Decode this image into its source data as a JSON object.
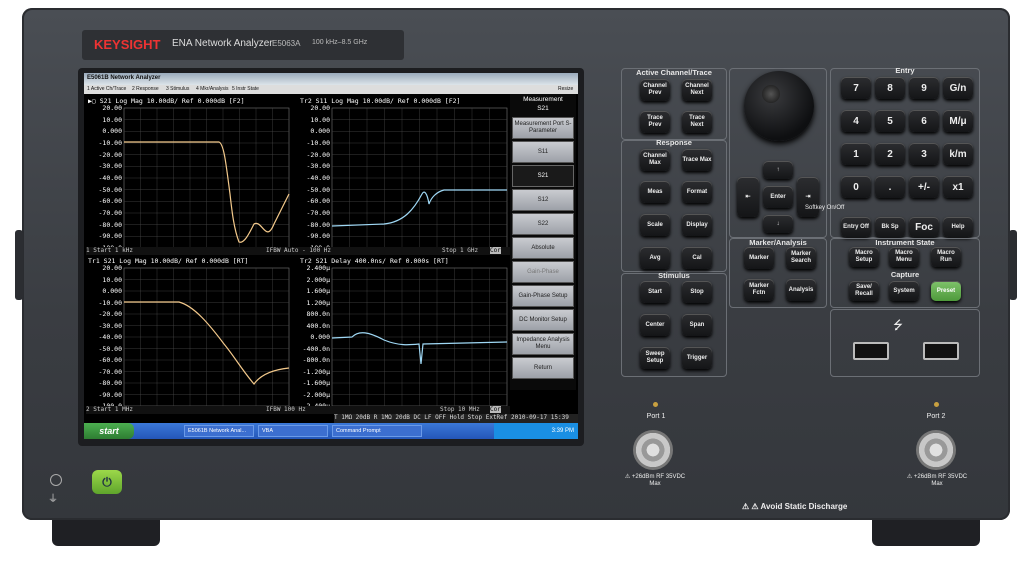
{
  "brand": {
    "logo": "KEYSIGHT",
    "product": "ENA Network Analyzer",
    "model": "E5063A",
    "range": "100 kHz–8.5 GHz"
  },
  "screen": {
    "window_title": "E5061B Network Analyzer",
    "menu": [
      "1 Active Ch/Trace",
      "2 Response",
      "3 Stimulus",
      "4 Mkr/Analysis",
      "5 Instr State"
    ],
    "menu_right": "Resize",
    "panels": [
      {
        "header": "S21 Log Mag 10.00dB/ Ref 0.000dB [F2]",
        "prefix": "Tr1",
        "yticks": [
          "20.00",
          "10.00",
          "0.000",
          "-10.00",
          "-20.00",
          "-30.00",
          "-40.00",
          "-50.00",
          "-60.00",
          "-70.00",
          "-80.00",
          "-90.00",
          "-100.0"
        ]
      },
      {
        "header": "Tr2 S11 Log Mag 10.00dB/ Ref 0.000dB [F2]",
        "yticks": [
          "20.00",
          "10.00",
          "0.000",
          "-10.00",
          "-20.00",
          "-30.00",
          "-40.00",
          "-50.00",
          "-60.00",
          "-70.00",
          "-80.00",
          "-90.00",
          "-100.0"
        ]
      },
      {
        "header": "Tr1 S21 Log Mag 10.00dB/ Ref 0.000dB [RT]",
        "yticks": [
          "20.00",
          "10.00",
          "0.000",
          "-10.00",
          "-20.00",
          "-30.00",
          "-40.00",
          "-50.00",
          "-60.00",
          "-70.00",
          "-80.00",
          "-90.00",
          "-100.0"
        ]
      },
      {
        "header": "Tr2 S21 Delay 400.0ns/ Ref 0.000s [RT]",
        "yticks": [
          "2.400μ",
          "2.000μ",
          "1.600μ",
          "1.200μ",
          "800.0n",
          "400.0n",
          "0.000",
          "-400.0n",
          "-800.0n",
          "-1.200μ",
          "-1.600μ",
          "-2.000μ",
          "-2.400μ"
        ]
      }
    ],
    "status1": {
      "start": "1 Start 1 kHz",
      "ifbw": "IFBW Auto - 100 Hz",
      "stop": "Stop 1 GHz",
      "cor": "Cor"
    },
    "status2": {
      "start": "2 Start 1 MHz",
      "ifbw": "IFBW 100 Hz",
      "stop": "Stop 10 MHz",
      "cor": "Cor"
    },
    "bottom_status": "T 1MΩ 20dB  R 1MΩ 20dB  DC LF OFF  Hold  Stop  ExtRef  2010-09-17 15:39",
    "softkeys": {
      "title": "Measurement",
      "subtitle": "S21",
      "items": [
        "Measurement Port S-Parameter",
        "S11",
        "S21",
        "S12",
        "S22",
        "Absolute",
        "Gain-Phase",
        "Gain-Phase Setup",
        "DC Monitor Setup",
        "Impedance Analysis Menu",
        "Return"
      ]
    },
    "taskbar": {
      "start": "start",
      "items": [
        "E5061B Network Anal...",
        "VBA",
        "Command Prompt"
      ],
      "clock": "3:39 PM"
    }
  },
  "keypad": {
    "active": {
      "title": "Active Channel/Trace",
      "keys": [
        "Channel Prev",
        "Channel Next",
        "Trace Prev",
        "Trace Next"
      ]
    },
    "response": {
      "title": "Response",
      "keys": [
        "Channel Max",
        "Trace Max",
        "Meas",
        "Format",
        "Scale",
        "Display",
        "Avg",
        "Cal"
      ]
    },
    "stimulus": {
      "title": "Stimulus",
      "keys": [
        "Start",
        "Stop",
        "Center",
        "Span",
        "Sweep Setup",
        "Trigger"
      ]
    },
    "nav": {
      "enter": "Enter"
    },
    "marker": {
      "title": "Marker/Analysis",
      "keys": [
        "Marker",
        "Marker Search",
        "Marker Fctn",
        "Analysis"
      ]
    },
    "entry": {
      "title": "Entry",
      "keys": [
        "7",
        "8",
        "9",
        "G/n",
        "4",
        "5",
        "6",
        "M/μ",
        "1",
        "2",
        "3",
        "k/m",
        "0",
        ".",
        "+/-",
        "x1",
        "Entry Off",
        "Bk Sp",
        "Foc",
        "Help"
      ],
      "softkey_label": "Softkey On/Off"
    },
    "instr": {
      "title": "Instrument State",
      "keys": [
        "Macro Setup",
        "Macro Menu",
        "Macro Run"
      ],
      "capture": "Capture",
      "capture_keys": [
        "Save/ Recall",
        "System",
        "Preset"
      ]
    }
  },
  "ports": {
    "p1": "Port 1",
    "p2": "Port 2",
    "rating": "+26dBm RF 35VDC Max"
  },
  "esd": "Avoid Static Discharge",
  "colors": {
    "trace1": "#f3c98b",
    "trace2": "#9fd8f5",
    "grid": "#4a4a4a"
  }
}
